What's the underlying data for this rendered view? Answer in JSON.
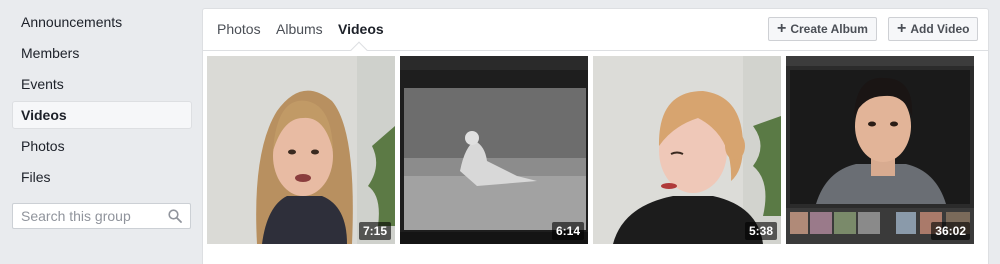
{
  "sidebar": {
    "items": [
      {
        "label": "Announcements"
      },
      {
        "label": "Members"
      },
      {
        "label": "Events"
      },
      {
        "label": "Videos",
        "active": true
      },
      {
        "label": "Photos"
      },
      {
        "label": "Files"
      }
    ],
    "search": {
      "placeholder": "Search this group",
      "icon": "search-icon"
    }
  },
  "tabs": [
    {
      "label": "Photos"
    },
    {
      "label": "Albums"
    },
    {
      "label": "Videos",
      "active": true
    }
  ],
  "actions": {
    "create_album": "Create Album",
    "add_video": "Add Video"
  },
  "videos": [
    {
      "duration": "7:15"
    },
    {
      "duration": "6:14"
    },
    {
      "duration": "5:38"
    },
    {
      "duration": "36:02"
    }
  ],
  "colors": {
    "background": "#e9ebee",
    "panel": "#ffffff",
    "border": "#dddfe2"
  }
}
